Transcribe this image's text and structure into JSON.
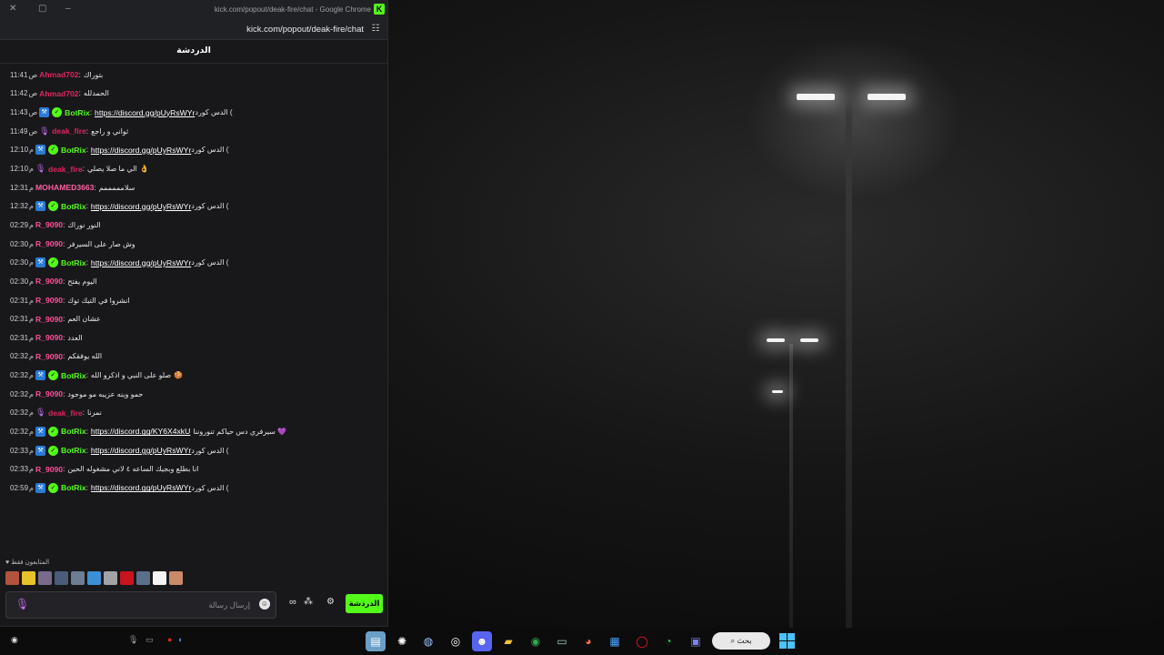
{
  "window": {
    "title": "kick.com/popout/deak-fire/chat - Google Chrome",
    "url": "kick.com/popout/deak-fire/chat",
    "kick_icon": "K"
  },
  "chat": {
    "header": "الدردشة",
    "messages": [
      {
        "time": "11:41",
        "ampm": "ص",
        "user": "Ahmad702",
        "color": "#e0245e",
        "badges": [],
        "text": "بتوراك",
        "link": "",
        "emoji": ""
      },
      {
        "time": "11:42",
        "ampm": "ص",
        "user": "Ahmad702",
        "color": "#e0245e",
        "badges": [],
        "text": "الحمدلله",
        "link": "",
        "emoji": ""
      },
      {
        "time": "11:43",
        "ampm": "ص",
        "user": "BotRix",
        "color": "#53fc18",
        "badges": [
          "bot",
          "verified"
        ],
        "text": "الدس كورد (",
        "link": "https://discord.gg/pUyRsWYr",
        "emoji": ""
      },
      {
        "time": "11:49",
        "ampm": "ص",
        "user": "deak_fire",
        "color": "#e0245e",
        "badges": [
          "mic"
        ],
        "text": "ثواني و راجع",
        "link": "",
        "emoji": ""
      },
      {
        "time": "12:10",
        "ampm": "م",
        "user": "BotRix",
        "color": "#53fc18",
        "badges": [
          "bot",
          "verified"
        ],
        "text": "الدس كورد (",
        "link": "https://discord.gg/pUyRsWYr",
        "emoji": ""
      },
      {
        "time": "12:10",
        "ampm": "م",
        "user": "deak_fire",
        "color": "#e0245e",
        "badges": [
          "mic"
        ],
        "text": "الي ما صلا يصلي",
        "link": "",
        "emoji": "👌"
      },
      {
        "time": "12:31",
        "ampm": "م",
        "user": "MOHAMED3663",
        "color": "#ff5fa2",
        "badges": [],
        "text": "سلامممممم",
        "link": "",
        "emoji": ""
      },
      {
        "time": "12:32",
        "ampm": "م",
        "user": "BotRix",
        "color": "#53fc18",
        "badges": [
          "bot",
          "verified"
        ],
        "text": "الدس كورد (",
        "link": "https://discord.gg/pUyRsWYr",
        "emoji": ""
      },
      {
        "time": "02:29",
        "ampm": "م",
        "user": "R_9090",
        "color": "#ff4f9a",
        "badges": [],
        "text": "النور نوراك",
        "link": "",
        "emoji": ""
      },
      {
        "time": "02:30",
        "ampm": "م",
        "user": "R_9090",
        "color": "#ff4f9a",
        "badges": [],
        "text": "وش صار على السيرفر",
        "link": "",
        "emoji": ""
      },
      {
        "time": "02:30",
        "ampm": "م",
        "user": "BotRix",
        "color": "#53fc18",
        "badges": [
          "bot",
          "verified"
        ],
        "text": "الدس كورد (",
        "link": "https://discord.gg/pUyRsWYr",
        "emoji": ""
      },
      {
        "time": "02:30",
        "ampm": "م",
        "user": "R_9090",
        "color": "#ff4f9a",
        "badges": [],
        "text": "اليوم يفتح",
        "link": "",
        "emoji": ""
      },
      {
        "time": "02:31",
        "ampm": "م",
        "user": "R_9090",
        "color": "#ff4f9a",
        "badges": [],
        "text": "انشروا في التيك توك",
        "link": "",
        "emoji": ""
      },
      {
        "time": "02:31",
        "ampm": "م",
        "user": "R_9090",
        "color": "#ff4f9a",
        "badges": [],
        "text": "عشان العم",
        "link": "",
        "emoji": ""
      },
      {
        "time": "02:31",
        "ampm": "م",
        "user": "R_9090",
        "color": "#ff4f9a",
        "badges": [],
        "text": "العدد",
        "link": "",
        "emoji": ""
      },
      {
        "time": "02:32",
        "ampm": "م",
        "user": "R_9090",
        "color": "#ff4f9a",
        "badges": [],
        "text": "الله يوفقكم",
        "link": "",
        "emoji": ""
      },
      {
        "time": "02:32",
        "ampm": "م",
        "user": "BotRix",
        "color": "#53fc18",
        "badges": [
          "bot",
          "verified"
        ],
        "text": "صلو على النبي و اذكرو الله",
        "link": "",
        "emoji": "🍪"
      },
      {
        "time": "02:32",
        "ampm": "م",
        "user": "R_9090",
        "color": "#ff4f9a",
        "badges": [],
        "text": "حمو وينه عزيبه مو موجود",
        "link": "",
        "emoji": ""
      },
      {
        "time": "02:32",
        "ampm": "م",
        "user": "deak_fire",
        "color": "#e0245e",
        "badges": [
          "mic"
        ],
        "text": "نمرنا",
        "link": "",
        "emoji": ""
      },
      {
        "time": "02:32",
        "ampm": "م",
        "user": "BotRix",
        "color": "#53fc18",
        "badges": [
          "bot",
          "verified"
        ],
        "text": "",
        "link": "https://discord.gg/KY6X4xkU",
        "emoji": "سيرفري دس حياكم تنوروننا 💜"
      },
      {
        "time": "02:33",
        "ampm": "م",
        "user": "BotRix",
        "color": "#53fc18",
        "badges": [
          "bot",
          "verified"
        ],
        "text": "الدس كورد (",
        "link": "https://discord.gg/pUyRsWYr",
        "emoji": ""
      },
      {
        "time": "02:33",
        "ampm": "م",
        "user": "R_9090",
        "color": "#ff4f9a",
        "badges": [],
        "text": "انا بطلع وبجيك الساعه ٤ لاني مشغوله الحين",
        "link": "",
        "emoji": ""
      },
      {
        "time": "02:59",
        "ampm": "م",
        "user": "BotRix",
        "color": "#53fc18",
        "badges": [
          "bot",
          "verified"
        ],
        "text": "الدس كورد (",
        "link": "https://discord.gg/pUyRsWYr",
        "emoji": ""
      }
    ],
    "supporters_label": "المتابعون فقط",
    "supporter_colors": [
      "#b5523b",
      "#e7c32b",
      "#7a6a8c",
      "#4a5c7a",
      "#6d7d92",
      "#3d8fd6",
      "#a3a3a3",
      "#c8151d",
      "#5a6f8a",
      "#f4f4f4",
      "#c98a6a"
    ],
    "input_placeholder": "إرسال رسالة",
    "send_label": "الدردشة"
  },
  "taskbar": {
    "search_label": "بحث",
    "apps": [
      "gallery-icon",
      "pinwheel-icon",
      "steam-icon",
      "obs-icon",
      "discord-icon",
      "folder-icon",
      "chrome-icon",
      "terminal-icon",
      "firefox-icon",
      "store-icon",
      "opera-icon",
      "whatsapp-icon",
      "teams-icon"
    ]
  },
  "colors": {
    "kick_green": "#53fc18",
    "chat_bg": "#18181b"
  }
}
